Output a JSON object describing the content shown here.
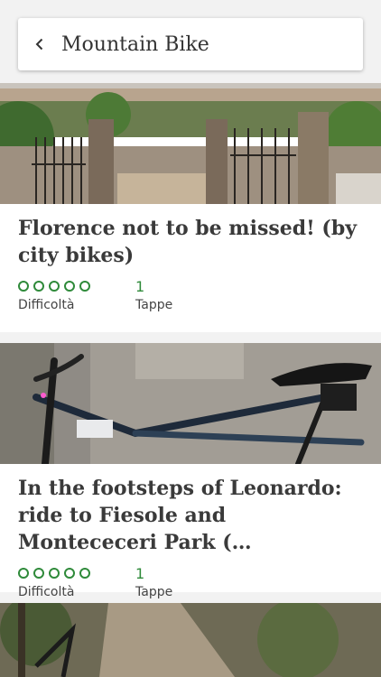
{
  "header": {
    "title": "Mountain Bike",
    "back_icon": "chevron-left-icon"
  },
  "routes": [
    {
      "title": "Florence not to be missed! (by city bikes)",
      "difficulty_label": "Difficoltà",
      "difficulty_stars": 0,
      "difficulty_max": 5,
      "stages_count": "1",
      "stages_label": "Tappe"
    },
    {
      "title": "In the footsteps of Leonardo: ride to Fiesole and Montececeri Park (…",
      "difficulty_label": "Difficoltà",
      "difficulty_stars": 0,
      "difficulty_max": 5,
      "stages_count": "1",
      "stages_label": "Tappe"
    }
  ],
  "colors": {
    "accent": "#2f8a3a",
    "text": "#3a3a3a",
    "background": "#f2f2f2"
  }
}
